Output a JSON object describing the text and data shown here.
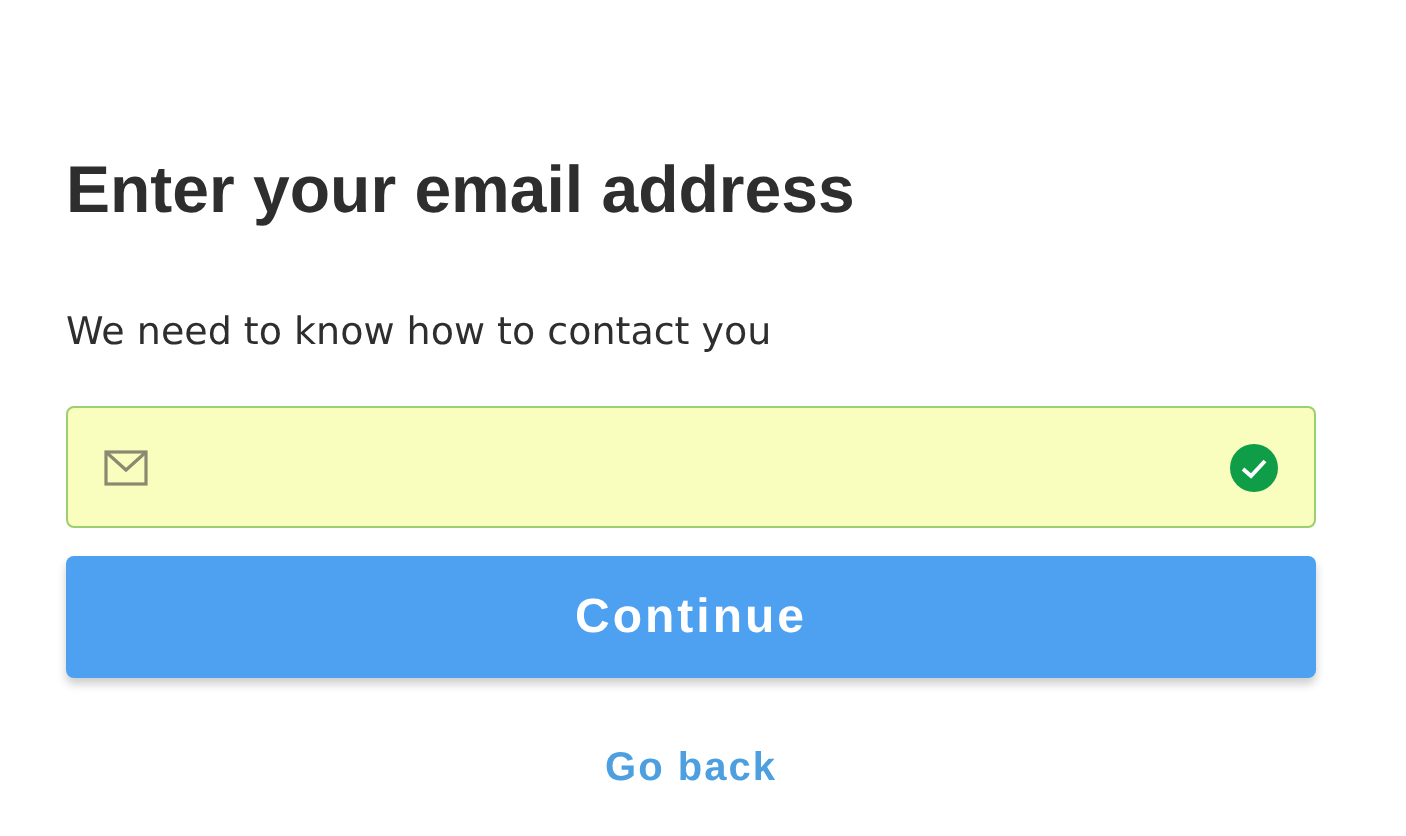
{
  "heading": "Enter your email address",
  "subheading": "We need to know how to contact you",
  "email_field": {
    "valid": true
  },
  "primary_button": "Continue",
  "back_link": "Go back"
}
